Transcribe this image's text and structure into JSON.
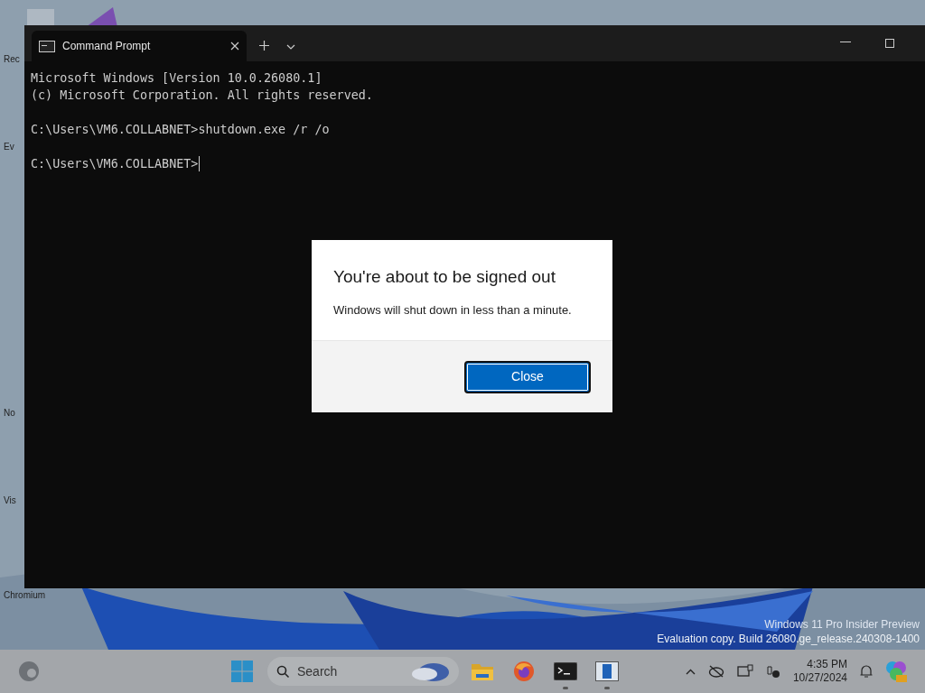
{
  "desktop_icons": [
    {
      "label": "Rec"
    },
    {
      "label": "Ev"
    },
    {
      "label": "No"
    },
    {
      "label": "Vis"
    },
    {
      "label": "Chromium"
    }
  ],
  "terminal": {
    "tabs": [
      {
        "title": "Command Prompt",
        "selected": true
      }
    ],
    "lines": [
      {
        "kind": "text",
        "text": "Microsoft Windows [Version 10.0.26080.1]"
      },
      {
        "kind": "text",
        "text": "(c) Microsoft Corporation. All rights reserved."
      },
      {
        "kind": "blank"
      },
      {
        "kind": "text",
        "text": "C:\\Users\\VM6.COLLABNET>shutdown.exe /r /o"
      },
      {
        "kind": "blank"
      },
      {
        "kind": "prompt",
        "text": "C:\\Users\\VM6.COLLABNET>"
      }
    ]
  },
  "dialog": {
    "title": "You're about to be signed out",
    "message": "Windows will shut down in less than a minute.",
    "button": "Close"
  },
  "watermark": [
    "Windows 11 Pro Insider Preview",
    "Evaluation copy. Build 26080.ge_release.240308-1400"
  ],
  "taskbar": {
    "search_placeholder": "Search",
    "apps": [
      {
        "kind": "folder",
        "running": false
      },
      {
        "kind": "firefox",
        "running": false
      },
      {
        "kind": "terminal",
        "running": true
      },
      {
        "kind": "window",
        "running": true
      }
    ],
    "time": "4:35 PM",
    "date": "10/27/2024"
  }
}
